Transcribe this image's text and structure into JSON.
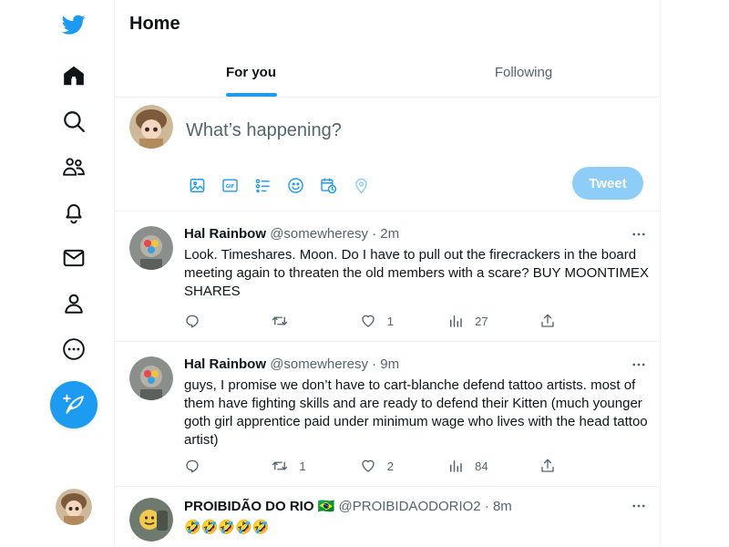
{
  "colors": {
    "accent": "#1d9bf0",
    "tweet_button_disabled": "#8ecdf8",
    "text_primary": "#0f1419",
    "text_secondary": "#536471",
    "border": "#eff3f4"
  },
  "nav": {
    "logo_icon": "twitter-bird-icon",
    "items": [
      {
        "icon": "home-icon"
      },
      {
        "icon": "search-icon"
      },
      {
        "icon": "communities-icon"
      },
      {
        "icon": "bell-icon"
      },
      {
        "icon": "mail-icon"
      },
      {
        "icon": "profile-icon"
      },
      {
        "icon": "more-circle-icon"
      }
    ],
    "compose_icon": "feather-plus-icon"
  },
  "header": {
    "title": "Home"
  },
  "tabs": [
    {
      "label": "For you",
      "active": true
    },
    {
      "label": "Following",
      "active": false
    }
  ],
  "composer": {
    "placeholder": "What’s happening?",
    "tools": [
      "image-icon",
      "gif-icon",
      "poll-icon",
      "emoji-icon",
      "schedule-icon",
      "location-icon"
    ],
    "tweet_label": "Tweet"
  },
  "tweets": [
    {
      "author": "Hal Rainbow",
      "handle": "@somewheresy",
      "sep": "·",
      "time": "2m",
      "text": "Look. Timeshares. Moon. Do I have to pull out the firecrackers in the board meeting again to threaten the old members with a scare? BUY MOONTIMEX SHARES",
      "replies": "",
      "retweets": "",
      "likes": "1",
      "views": "27"
    },
    {
      "author": "Hal Rainbow",
      "handle": "@somewheresy",
      "sep": "·",
      "time": "9m",
      "text": "guys, I promise we don’t have to cart-blanche defend tattoo artists. most of them have fighting skills and are ready to defend their Kitten (much younger goth girl apprentice paid under minimum wage who lives with the head tattoo artist)",
      "replies": "",
      "retweets": "1",
      "likes": "2",
      "views": "84"
    },
    {
      "author": "PROIBIDÃO DO RIO 🇧🇷",
      "handle": "@PROIBIDAODORIO2",
      "sep": "·",
      "time": "8m",
      "text": "🤣🤣🤣🤣🤣"
    }
  ]
}
